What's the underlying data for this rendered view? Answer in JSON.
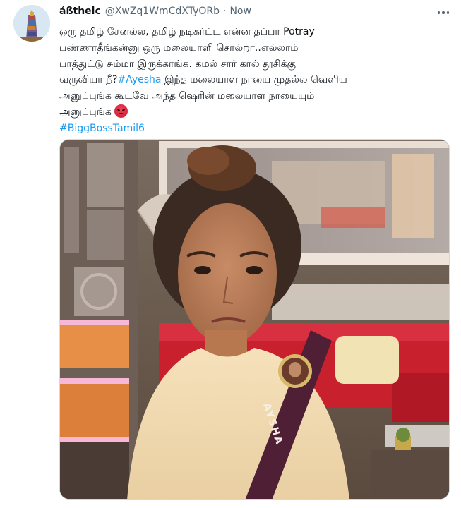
{
  "tweet": {
    "display_name": "áßtheic",
    "handle": "@XwZq1WmCdXTyORb",
    "dot": "·",
    "time": "Now",
    "lines": [
      "ஒரு தமிழ் சேனல்ல, தமிழ் நடிகர்ட்ட என்ன தப்பா Potray",
      "பண்ணாதீங்கன்னு ஒரு மலையாளி சொல்றா..எல்லாம்",
      "பாத்துட்டு சும்மா இருக்காங்க. கமல் சார் கால் தூசிக்கு",
      "வருவியா நீ?",
      "இந்த மலையாள நாயை முதல்ல வெளிய",
      "அனுப்புங்க கூடவே அந்த ஷெரின் மலையாள நாயையும்",
      "அனுப்புங்க"
    ],
    "hashtag_ayesha": "#Ayesha",
    "hashtag_biggboss": "#BiggBossTamil6",
    "emoji": "angry-face-emoji",
    "badge_text": "AYSHA"
  },
  "colors": {
    "link": "#1d9bf0",
    "secondary": "#536471",
    "text": "#0f1419"
  }
}
